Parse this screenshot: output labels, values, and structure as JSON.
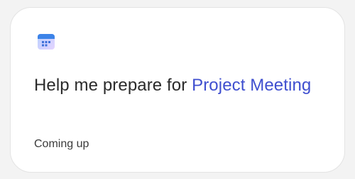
{
  "card": {
    "icon": "calendar-icon",
    "headline_prefix": "Help me prepare for ",
    "event_name": "Project Meeting",
    "status": "Coming up"
  },
  "colors": {
    "page_background": "#f3f3f3",
    "card_background": "#ffffff",
    "headline_text": "#2b2b2b",
    "event_link": "#3f4fcf",
    "icon_header": "#3c83e8",
    "icon_body": "#c9d7ff"
  }
}
